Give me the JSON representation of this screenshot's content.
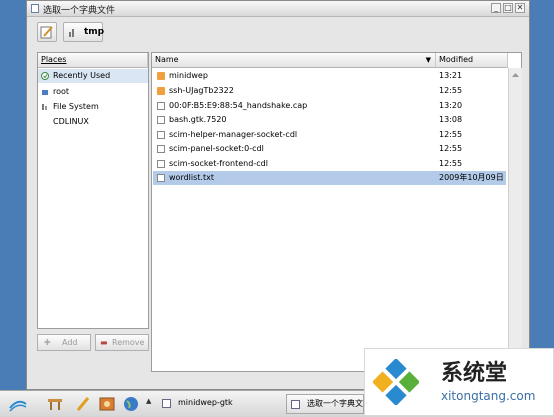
{
  "window": {
    "title": "选取一个字典文件",
    "minimize": "_",
    "maximize": "□",
    "close": "✕"
  },
  "toolbar": {
    "path_button": "tmp"
  },
  "places": {
    "header": "Places",
    "items": [
      {
        "label": "Recently Used",
        "icon": "recent-icon"
      },
      {
        "label": "root",
        "icon": "home-icon"
      },
      {
        "label": "File System",
        "icon": "drive-icon"
      },
      {
        "label": "CDLINUX",
        "icon": "none"
      }
    ],
    "add_label": "Add",
    "remove_label": "Remove"
  },
  "files": {
    "columns": {
      "name": "Name",
      "modified": "Modified"
    },
    "rows": [
      {
        "name": "minidwep",
        "modified": "13:21",
        "type": "folder"
      },
      {
        "name": "ssh-UJagTb2322",
        "modified": "12:55",
        "type": "folder"
      },
      {
        "name": "00:0F:B5:E9:88:54_handshake.cap",
        "modified": "13:20",
        "type": "file"
      },
      {
        "name": "bash.gtk.7520",
        "modified": "13:08",
        "type": "file"
      },
      {
        "name": "scim-helper-manager-socket-cdl",
        "modified": "12:55",
        "type": "file"
      },
      {
        "name": "scim-panel-socket:0-cdl",
        "modified": "12:55",
        "type": "file"
      },
      {
        "name": "scim-socket-frontend-cdl",
        "modified": "12:55",
        "type": "file"
      },
      {
        "name": "wordlist.txt",
        "modified": "2009年10月09日",
        "type": "file",
        "selected": true
      }
    ]
  },
  "taskbar": {
    "tasks": [
      {
        "label": "minidwep-gtk"
      },
      {
        "label": "选取一个字典文"
      }
    ]
  },
  "watermark": {
    "brand": "系统堂",
    "url": "xitongtang.com"
  },
  "colors": {
    "desktop": "#3a6ea5",
    "selection": "#b3cbe9",
    "folder": "#f0a040"
  }
}
